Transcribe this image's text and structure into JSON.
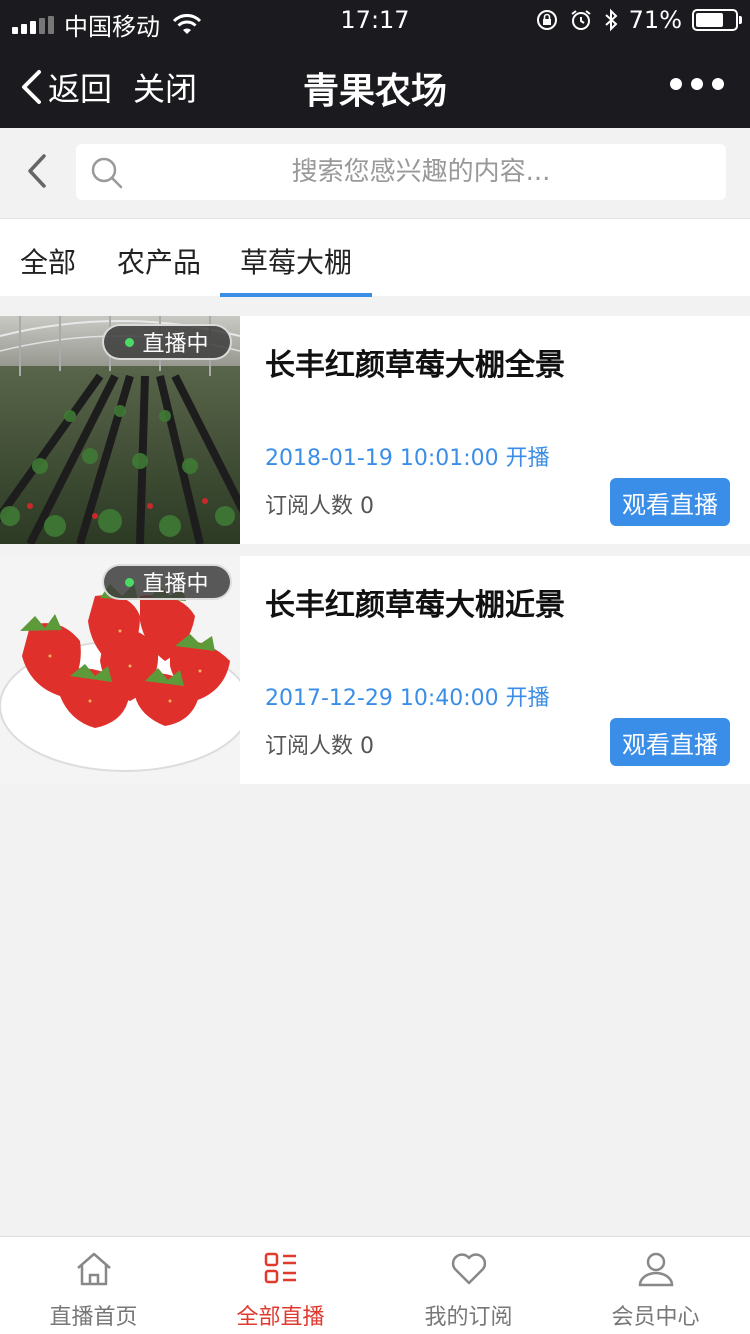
{
  "status": {
    "carrier": "中国移动",
    "time": "17:17",
    "battery": "71%",
    "battery_level": 0.71
  },
  "nav": {
    "back_label": "返回",
    "close_label": "关闭",
    "title": "青果农场"
  },
  "search": {
    "placeholder": "搜索您感兴趣的内容..."
  },
  "tabs": [
    {
      "label": "全部"
    },
    {
      "label": "农产品"
    },
    {
      "label": "草莓大棚",
      "active": true
    }
  ],
  "streams": [
    {
      "title": "长丰红颜草莓大棚全景",
      "badge": "直播中",
      "start_time": "2018-01-19 10:01:00 开播",
      "subscribers": "订阅人数 0",
      "button": "观看直播"
    },
    {
      "title": "长丰红颜草莓大棚近景",
      "badge": "直播中",
      "start_time": "2017-12-29 10:40:00 开播",
      "subscribers": "订阅人数 0",
      "button": "观看直播"
    }
  ],
  "bottom_nav": [
    {
      "label": "直播首页",
      "icon": "home-icon"
    },
    {
      "label": "全部直播",
      "icon": "list-icon",
      "active": true
    },
    {
      "label": "我的订阅",
      "icon": "heart-icon"
    },
    {
      "label": "会员中心",
      "icon": "user-icon"
    }
  ],
  "colors": {
    "topbar": "#1b1b1f",
    "accent_blue": "#3b8ee8",
    "active_red": "#e03a2f",
    "live_dot": "#4cd964"
  }
}
